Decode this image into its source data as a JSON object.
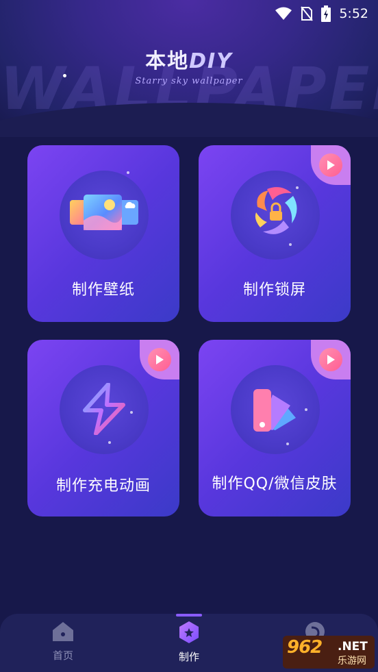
{
  "status_bar": {
    "time": "5:52",
    "icons": [
      "wifi-icon",
      "no-sim-icon",
      "battery-charging-icon"
    ]
  },
  "header": {
    "title_main": "本地",
    "title_accent": "DIY",
    "subtitle": "Starry sky wallpaper",
    "watermark": "WALLPAPER"
  },
  "cards": [
    {
      "label": "制作壁纸",
      "icon": "wallpaper-icon",
      "has_video_badge": false
    },
    {
      "label": "制作锁屏",
      "icon": "lock-screen-icon",
      "has_video_badge": true
    },
    {
      "label": "制作充电动画",
      "icon": "charging-bolt-icon",
      "has_video_badge": true
    },
    {
      "label": "制作QQ/微信皮肤",
      "icon": "color-palette-icon",
      "has_video_badge": true
    }
  ],
  "bottom_nav": {
    "items": [
      {
        "label": "首页",
        "icon": "home-icon",
        "active": false
      },
      {
        "label": "制作",
        "icon": "make-star-icon",
        "active": true
      },
      {
        "label": "",
        "icon": "profile-icon",
        "active": false
      }
    ]
  },
  "brand_badge": {
    "number": "962",
    "suffix": ".NET",
    "site_name": "乐游网"
  },
  "colors": {
    "background": "#17184a",
    "card_gradient_start": "#7c44f2",
    "card_gradient_end": "#3b3ac8",
    "accent": "#8a5cff",
    "play_badge": "#ff5f92"
  }
}
